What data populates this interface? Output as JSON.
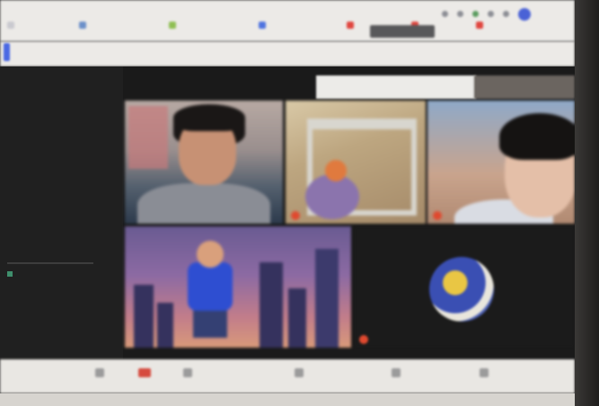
{
  "browser": {
    "bookmarks": [
      {
        "label": "",
        "color": "#c9c9cf"
      },
      {
        "label": "",
        "color": "#6c90c9"
      },
      {
        "label": "",
        "color": "#8fbf53"
      },
      {
        "label": "",
        "color": "#4f73e0"
      },
      {
        "label": "",
        "color": "#e0463f"
      },
      {
        "label": "",
        "color": "#e0463f"
      },
      {
        "label": "",
        "color": "#e0463f"
      }
    ],
    "page_link": ""
  },
  "meeting": {
    "side_panel_label": "",
    "view_controls": [
      "",
      "",
      ""
    ],
    "participants": [
      {
        "name": ""
      },
      {
        "name": ""
      },
      {
        "name": ""
      },
      {
        "name": ""
      },
      {
        "name": ""
      }
    ]
  },
  "controls": [
    {
      "label": "",
      "icon": "mic-icon"
    },
    {
      "label": "",
      "icon": "end-call-icon"
    },
    {
      "label": "",
      "icon": "camera-icon"
    },
    {
      "label": "",
      "icon": "hand-icon"
    },
    {
      "label": "",
      "icon": "share-screen-icon"
    },
    {
      "label": "",
      "icon": "participants-icon"
    }
  ]
}
